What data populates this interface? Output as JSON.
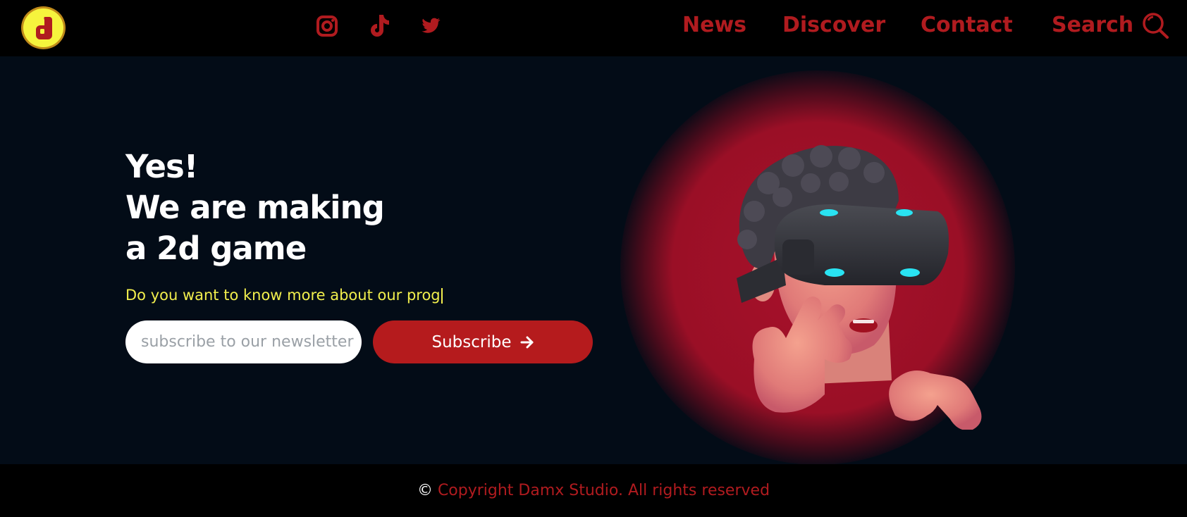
{
  "header": {
    "logo_alt": "d",
    "social": [
      {
        "name": "instagram"
      },
      {
        "name": "tiktok"
      },
      {
        "name": "twitter"
      }
    ],
    "nav": {
      "news": "News",
      "discover": "Discover",
      "contact": "Contact",
      "search": "Search"
    }
  },
  "hero": {
    "headline_line1": "Yes!",
    "headline_line2": "We are making",
    "headline_line3": "a 2d game",
    "tagline": "Do you want to know more about our prog",
    "newsletter_placeholder": "subscribe to our newsletter",
    "subscribe_label": "Subscribe"
  },
  "footer": {
    "copy_symbol": "©",
    "copyright": "Copyright Damx Studio. All rights reserved"
  },
  "colors": {
    "accent_red": "#b51b1d",
    "logo_yellow": "#f6f43d",
    "tagline_yellow": "#f2ef4d",
    "background": "#030c17"
  }
}
